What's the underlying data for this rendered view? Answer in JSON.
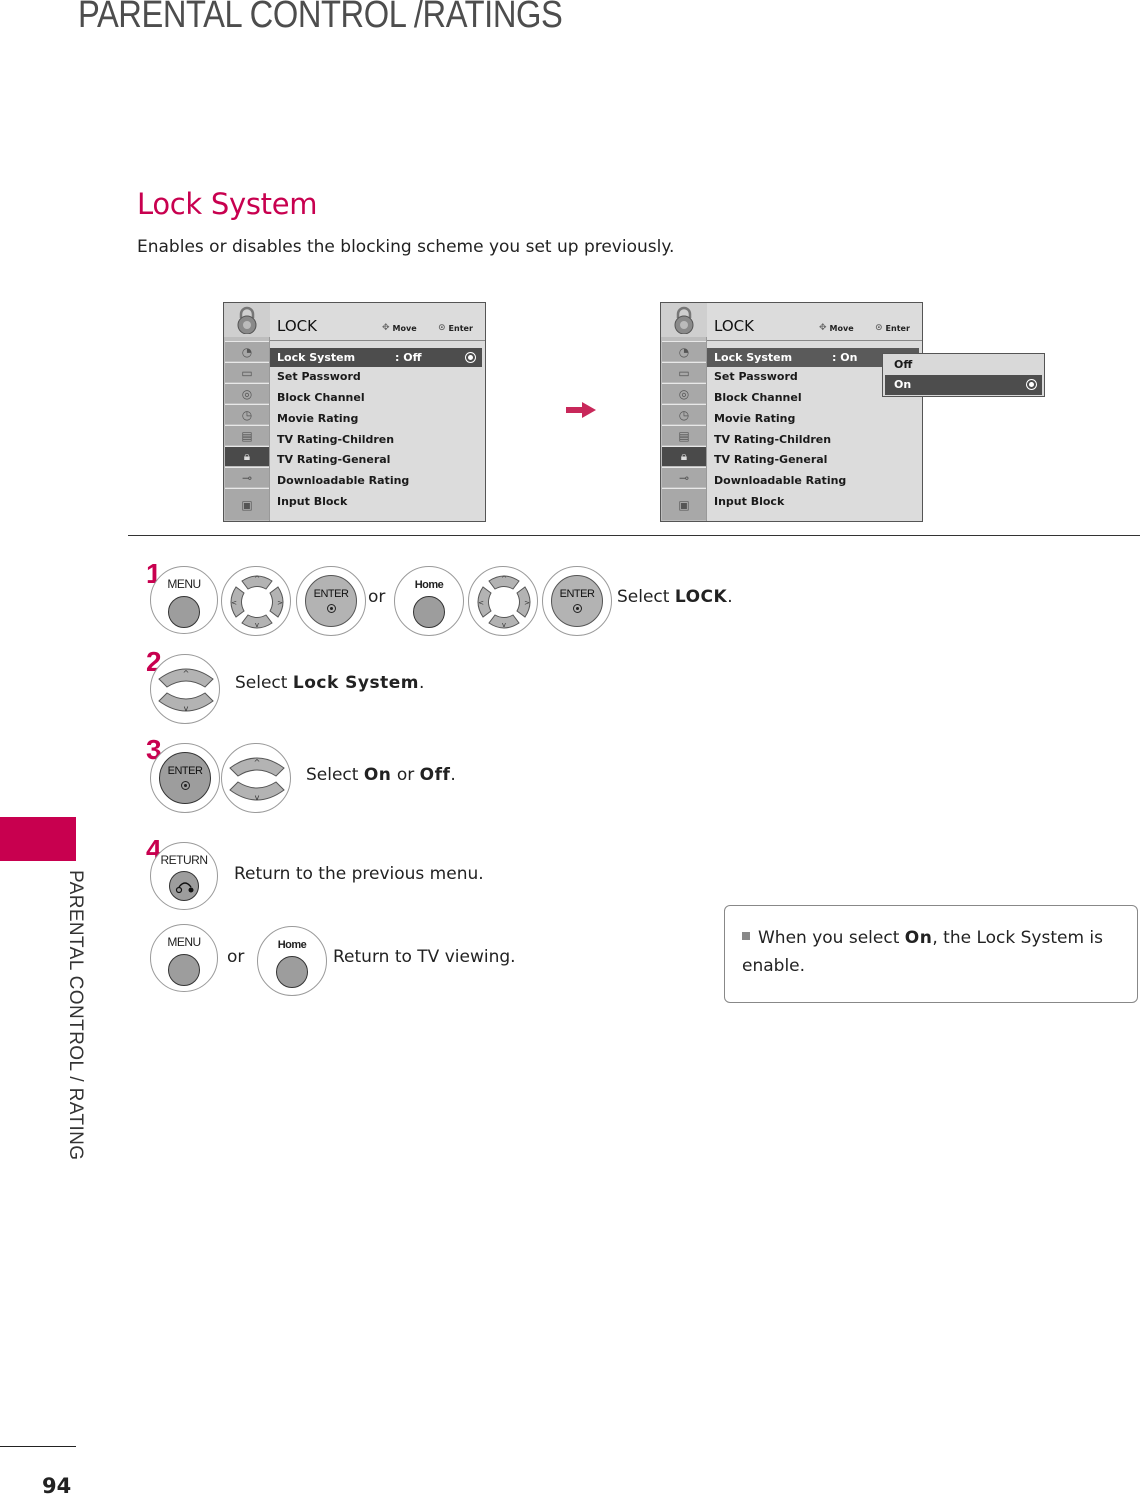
{
  "page": {
    "title": "PARENTAL CONTROL /RATINGS",
    "side_label": "PARENTAL CONTROL / RATING",
    "page_number": "94",
    "accent_color": "#c8004f"
  },
  "section": {
    "heading": "Lock System",
    "description": "Enables or disables the blocking scheme you set up previously."
  },
  "osd_before": {
    "menu_title": "LOCK",
    "hint_move": "Move",
    "hint_enter": "Enter",
    "selected_label": "Lock System",
    "selected_value": ": Off",
    "items": [
      "Set Password",
      "Block Channel",
      "Movie Rating",
      "TV Rating-Children",
      "TV Rating-General",
      "Downloadable Rating",
      "Input Block"
    ],
    "side_icons": [
      "lock-icon",
      "satellite-icon",
      "tv-screen-icon",
      "speaker-icon",
      "clock-icon",
      "toolbox-icon",
      "padlock-icon",
      "cable-icon",
      "photo-icon"
    ]
  },
  "osd_after": {
    "menu_title": "LOCK",
    "hint_move": "Move",
    "hint_enter": "Enter",
    "selected_label": "Lock System",
    "selected_value": ": On",
    "items": [
      "Set Password",
      "Block Channel",
      "Movie Rating",
      "TV Rating-Children",
      "TV Rating-General",
      "Downloadable Rating",
      "Input Block"
    ],
    "popup_options": [
      "Off",
      "On"
    ],
    "popup_selected": "On"
  },
  "steps": {
    "step1": {
      "number": "1",
      "btn_menu": "MENU",
      "btn_enter": "ENTER",
      "or": "or",
      "btn_home": "Home",
      "text_prefix": "Select ",
      "text_bold": "LOCK",
      "text_suffix": "."
    },
    "step2": {
      "number": "2",
      "text_prefix": "Select ",
      "text_bold": "Lock System",
      "text_suffix": "."
    },
    "step3": {
      "number": "3",
      "btn_enter": "ENTER",
      "text_prefix": "Select ",
      "text_bold1": "On",
      "text_mid": " or ",
      "text_bold2": "Off",
      "text_suffix": "."
    },
    "step4": {
      "number": "4",
      "btn_return": "RETURN",
      "text": "Return to the previous menu."
    },
    "step5": {
      "btn_menu": "MENU",
      "or": "or",
      "btn_home": "Home",
      "text": "Return to TV viewing."
    }
  },
  "note": {
    "prefix": "When you select ",
    "bold": "On",
    "suffix": ", the Lock System is enable."
  }
}
